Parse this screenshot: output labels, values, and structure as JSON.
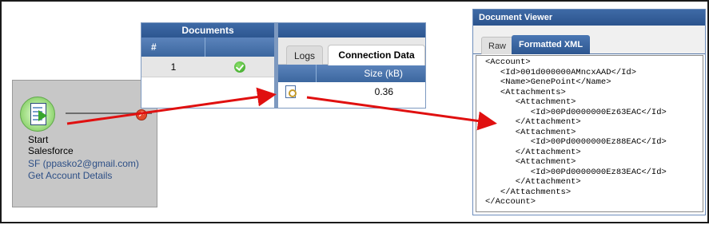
{
  "start_node": {
    "title": "Start",
    "type": "Salesforce",
    "account": "SF (ppasko2@gmail.com)",
    "action": "Get Account Details"
  },
  "documents": {
    "title": "Documents",
    "col_num": "#",
    "rows": [
      {
        "num": "1",
        "status": "success"
      }
    ]
  },
  "connection": {
    "tabs": [
      "Logs",
      "Connection Data"
    ],
    "active_tab": "Connection Data",
    "col_size": "Size (kB)",
    "rows": [
      {
        "size": "0.36"
      }
    ]
  },
  "viewer": {
    "title": "Document Viewer",
    "tab_raw": "Raw",
    "tab_formatted": "Formatted XML",
    "active_tab": "Formatted XML",
    "xml_lines": [
      "<Account>",
      "   <Id>001d000000AMncxAAD</Id>",
      "   <Name>GenePoint</Name>",
      "   <Attachments>",
      "      <Attachment>",
      "         <Id>00Pd0000000Ez63EAC</Id>",
      "      </Attachment>",
      "      <Attachment>",
      "         <Id>00Pd0000000Ez88EAC</Id>",
      "      </Attachment>",
      "      <Attachment>",
      "         <Id>00Pd0000000Ez83EAC</Id>",
      "      </Attachment>",
      "   </Attachments>",
      "</Account>"
    ]
  },
  "colors": {
    "header_blue": "#2d5690",
    "arrow_red": "#e01010",
    "node_gray": "#c7c7c7",
    "link_blue": "#2d4f86"
  }
}
